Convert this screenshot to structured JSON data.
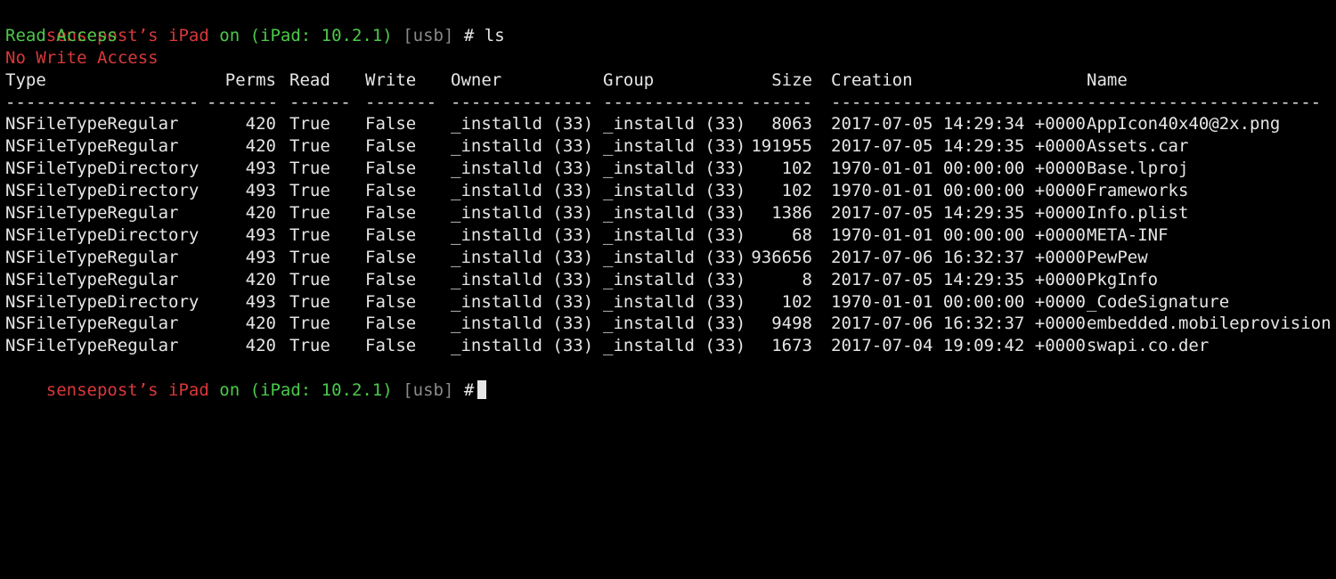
{
  "prompt": {
    "host": "sensepost’s iPad",
    "on": "on",
    "device": "(iPad: 10.2.1)",
    "transport": "[usb]",
    "hash": "#",
    "command": "ls"
  },
  "access": {
    "read": "Read Access",
    "write": "No Write Access"
  },
  "table": {
    "headers": {
      "type": "Type",
      "perms": "Perms",
      "read": "Read",
      "write": "Write",
      "owner": "Owner",
      "group": "Group",
      "size": "Size",
      "creation": "Creation",
      "name": "Name"
    },
    "separators": {
      "type": "-------------------",
      "perms": "-------",
      "read": "------",
      "write": "-------",
      "owner": "--------------",
      "group": "--------------",
      "size": "------",
      "creation": "-------------------------",
      "name": "-----------------------"
    },
    "rows": [
      {
        "type": "NSFileTypeRegular",
        "perms": "420",
        "read": "True",
        "write": "False",
        "owner": "_installd (33)",
        "group": "_installd (33)",
        "size": "8063",
        "creation": "2017-07-05 14:29:34 +0000",
        "name": "AppIcon40x40@2x.png"
      },
      {
        "type": "NSFileTypeRegular",
        "perms": "420",
        "read": "True",
        "write": "False",
        "owner": "_installd (33)",
        "group": "_installd (33)",
        "size": "191955",
        "creation": "2017-07-05 14:29:35 +0000",
        "name": "Assets.car"
      },
      {
        "type": "NSFileTypeDirectory",
        "perms": "493",
        "read": "True",
        "write": "False",
        "owner": "_installd (33)",
        "group": "_installd (33)",
        "size": "102",
        "creation": "1970-01-01 00:00:00 +0000",
        "name": "Base.lproj"
      },
      {
        "type": "NSFileTypeDirectory",
        "perms": "493",
        "read": "True",
        "write": "False",
        "owner": "_installd (33)",
        "group": "_installd (33)",
        "size": "102",
        "creation": "1970-01-01 00:00:00 +0000",
        "name": "Frameworks"
      },
      {
        "type": "NSFileTypeRegular",
        "perms": "420",
        "read": "True",
        "write": "False",
        "owner": "_installd (33)",
        "group": "_installd (33)",
        "size": "1386",
        "creation": "2017-07-05 14:29:35 +0000",
        "name": "Info.plist"
      },
      {
        "type": "NSFileTypeDirectory",
        "perms": "493",
        "read": "True",
        "write": "False",
        "owner": "_installd (33)",
        "group": "_installd (33)",
        "size": "68",
        "creation": "1970-01-01 00:00:00 +0000",
        "name": "META-INF"
      },
      {
        "type": "NSFileTypeRegular",
        "perms": "493",
        "read": "True",
        "write": "False",
        "owner": "_installd (33)",
        "group": "_installd (33)",
        "size": "936656",
        "creation": "2017-07-06 16:32:37 +0000",
        "name": "PewPew"
      },
      {
        "type": "NSFileTypeRegular",
        "perms": "420",
        "read": "True",
        "write": "False",
        "owner": "_installd (33)",
        "group": "_installd (33)",
        "size": "8",
        "creation": "2017-07-05 14:29:35 +0000",
        "name": "PkgInfo"
      },
      {
        "type": "NSFileTypeDirectory",
        "perms": "493",
        "read": "True",
        "write": "False",
        "owner": "_installd (33)",
        "group": "_installd (33)",
        "size": "102",
        "creation": "1970-01-01 00:00:00 +0000",
        "name": "_CodeSignature"
      },
      {
        "type": "NSFileTypeRegular",
        "perms": "420",
        "read": "True",
        "write": "False",
        "owner": "_installd (33)",
        "group": "_installd (33)",
        "size": "9498",
        "creation": "2017-07-06 16:32:37 +0000",
        "name": "embedded.mobileprovision"
      },
      {
        "type": "NSFileTypeRegular",
        "perms": "420",
        "read": "True",
        "write": "False",
        "owner": "_installd (33)",
        "group": "_installd (33)",
        "size": "1673",
        "creation": "2017-07-04 19:09:42 +0000",
        "name": "swapi.co.der"
      }
    ]
  },
  "colors": {
    "background": "#000000",
    "text": "#e6e6e6",
    "host": "#d9383a",
    "device": "#4cc94a",
    "transport": "#8a8a8a",
    "read_access": "#4cc94a",
    "no_write_access": "#d9383a"
  }
}
